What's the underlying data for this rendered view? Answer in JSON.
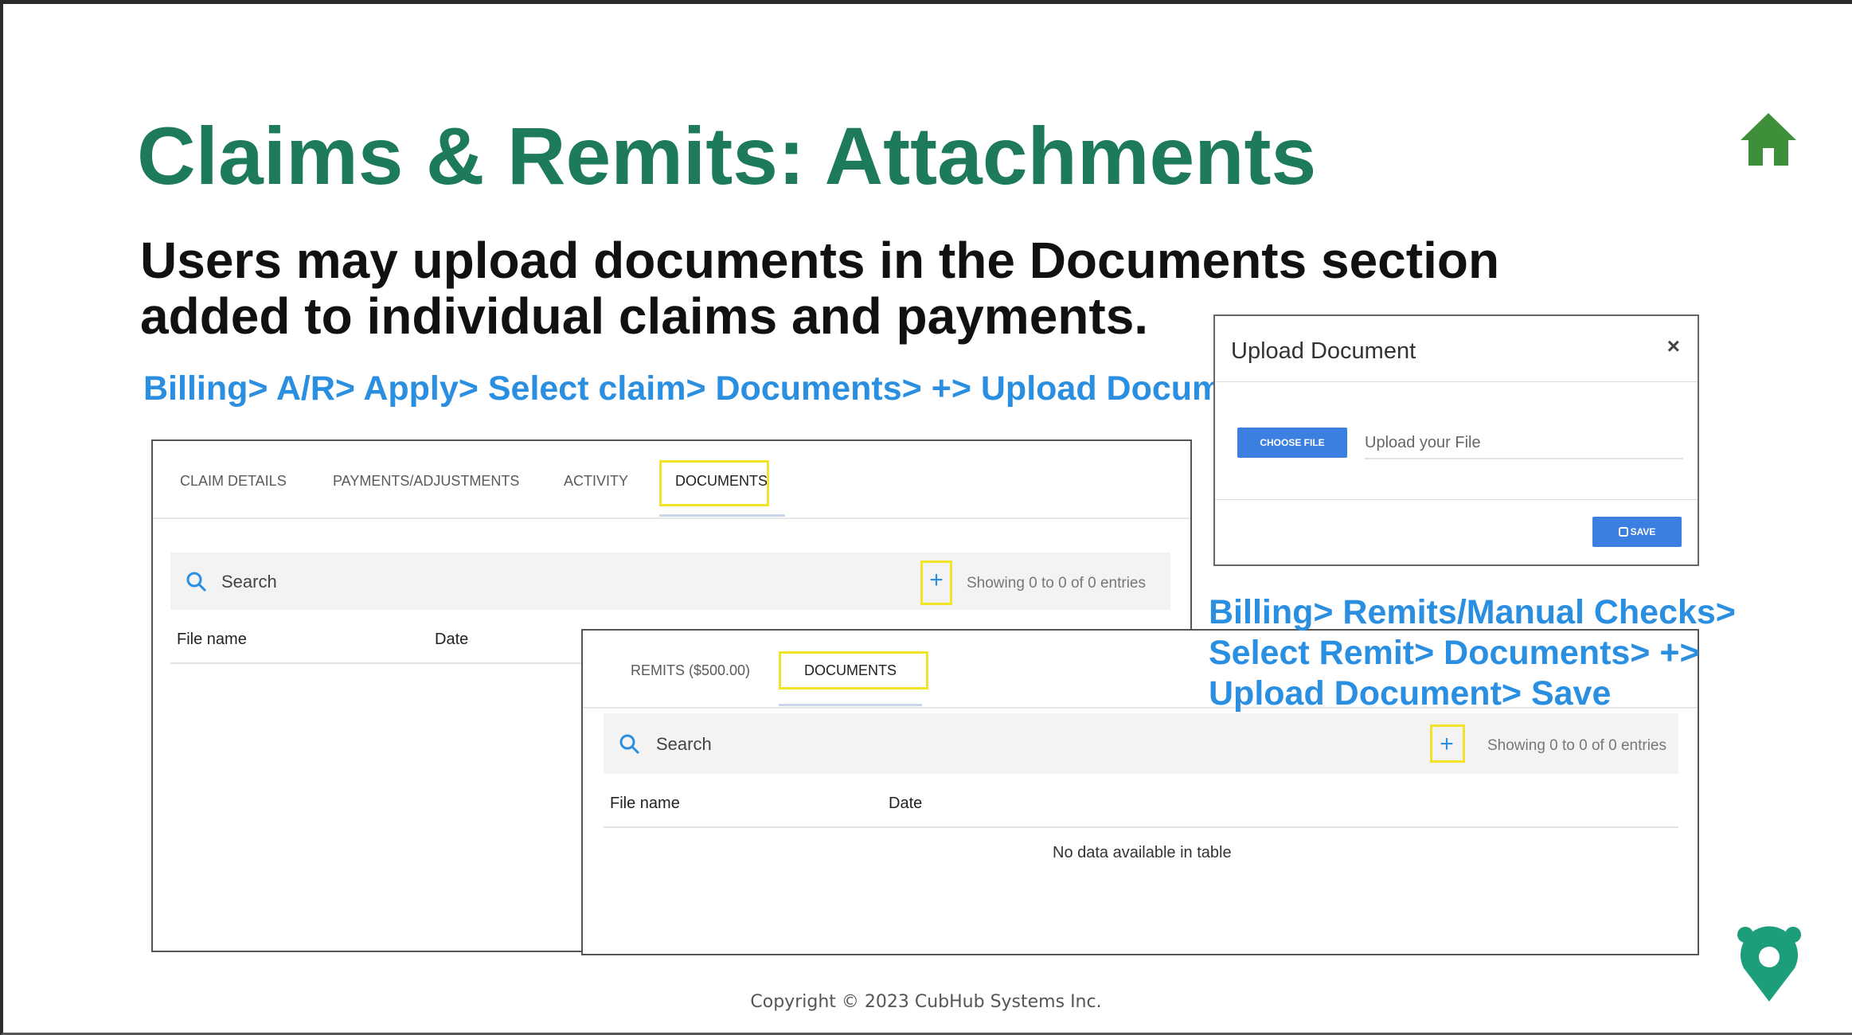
{
  "slide": {
    "title": "Claims & Remits: Attachments",
    "subtitle": "Users may upload documents in the Documents section added to individual claims and payments.",
    "path_claims": "Billing> A/R> Apply> Select claim> Documents> +> Upload Document> Save",
    "path_remits": "Billing> Remits/Manual Checks> Select Remit> Documents> +> Upload Document> Save",
    "copyright": "Copyright © 2023 CubHub Systems Inc.",
    "colors": {
      "title": "#1d7a5c",
      "path": "#2a8fe0",
      "highlight": "#f2e22a",
      "button": "#3b7fe0"
    }
  },
  "claim_panel": {
    "tabs": [
      "CLAIM DETAILS",
      "PAYMENTS/ADJUSTMENTS",
      "ACTIVITY",
      "DOCUMENTS"
    ],
    "active_tab": "DOCUMENTS",
    "search_label": "Search",
    "add_icon": "+",
    "entries": "Showing 0 to 0 of 0 entries",
    "columns": [
      "File name",
      "Date"
    ]
  },
  "remit_panel": {
    "tabs": [
      "REMITS ($500.00)",
      "DOCUMENTS"
    ],
    "active_tab": "DOCUMENTS",
    "search_label": "Search",
    "add_icon": "+",
    "entries": "Showing 0 to 0 of 0 entries",
    "columns": [
      "File name",
      "Date"
    ],
    "empty_message": "No data available in table"
  },
  "upload_dialog": {
    "title": "Upload Document",
    "close": "×",
    "choose_file_label": "CHOOSE FILE",
    "file_placeholder": "Upload your File",
    "save_label": "SAVE"
  },
  "icons": {
    "home": "home-icon",
    "brand": "cubhub-badge-icon",
    "search": "search-icon"
  }
}
